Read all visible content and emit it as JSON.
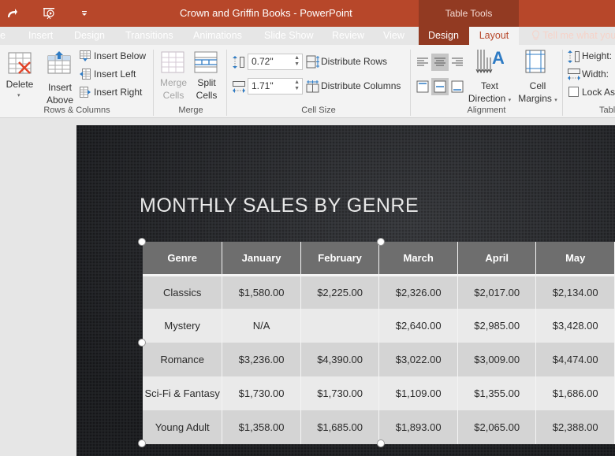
{
  "window": {
    "title": "Crown and Griffin Books - PowerPoint",
    "context_group": "Table Tools"
  },
  "qat": {
    "icons": [
      "redo-icon",
      "slideshow-from-start-icon",
      "customize-qat-icon"
    ]
  },
  "tabs": [
    {
      "label": "e",
      "active": false
    },
    {
      "label": "Insert",
      "active": false
    },
    {
      "label": "Design",
      "active": false
    },
    {
      "label": "Transitions",
      "active": false
    },
    {
      "label": "Animations",
      "active": false
    },
    {
      "label": "Slide Show",
      "active": false
    },
    {
      "label": "Review",
      "active": false
    },
    {
      "label": "View",
      "active": false
    },
    {
      "label": "Design",
      "active": false
    },
    {
      "label": "Layout",
      "active": true
    }
  ],
  "tell_me": "Tell me what you",
  "ribbon": {
    "rows_columns": {
      "label": "Rows & Columns",
      "delete": "Delete",
      "insert_above_line1": "Insert",
      "insert_above_line2": "Above",
      "insert_below": "Insert Below",
      "insert_left": "Insert Left",
      "insert_right": "Insert Right"
    },
    "merge": {
      "label": "Merge",
      "merge_cells_line1": "Merge",
      "merge_cells_line2": "Cells",
      "split_cells_line1": "Split",
      "split_cells_line2": "Cells"
    },
    "cell_size": {
      "label": "Cell Size",
      "height_value": "0.72\"",
      "width_value": "1.71\"",
      "distribute_rows": "Distribute Rows",
      "distribute_columns": "Distribute Columns"
    },
    "alignment": {
      "label": "Alignment",
      "text_direction_line1": "Text",
      "text_direction_line2": "Direction",
      "cell_margins_line1": "Cell",
      "cell_margins_line2": "Margins",
      "horizontal_selected": "center",
      "vertical_selected": "middle"
    },
    "table_size": {
      "label": "Tabl",
      "height_label": "Height:",
      "width_label": "Width:",
      "lock_aspect_label": "Lock As",
      "lock_aspect_checked": false
    }
  },
  "slide": {
    "title": "MONTHLY SALES BY GENRE",
    "table": {
      "headers": [
        "Genre",
        "January",
        "February",
        "March",
        "April",
        "May"
      ],
      "rows": [
        [
          "Classics",
          "$1,580.00",
          "$2,225.00",
          "$2,326.00",
          "$2,017.00",
          "$2,134.00"
        ],
        [
          "Mystery",
          "N/A",
          "",
          "$2,640.00",
          "$2,985.00",
          "$3,428.00"
        ],
        [
          "Romance",
          "$3,236.00",
          "$4,390.00",
          "$3,022.00",
          "$3,009.00",
          "$4,474.00"
        ],
        [
          "Sci-Fi & Fantasy",
          "$1,730.00",
          "$1,730.00",
          "$1,109.00",
          "$1,355.00",
          "$1,686.00"
        ],
        [
          "Young Adult",
          "$1,358.00",
          "$1,685.00",
          "$1,893.00",
          "$2,065.00",
          "$2,388.00"
        ]
      ]
    }
  },
  "colors": {
    "accent": "#b7472a",
    "context_tab": "#923a22",
    "ribbon_bg": "#f3f3f3",
    "table_header": "#6e6e6e",
    "row_dark": "#d4d4d4",
    "row_light": "#eaeaea"
  }
}
